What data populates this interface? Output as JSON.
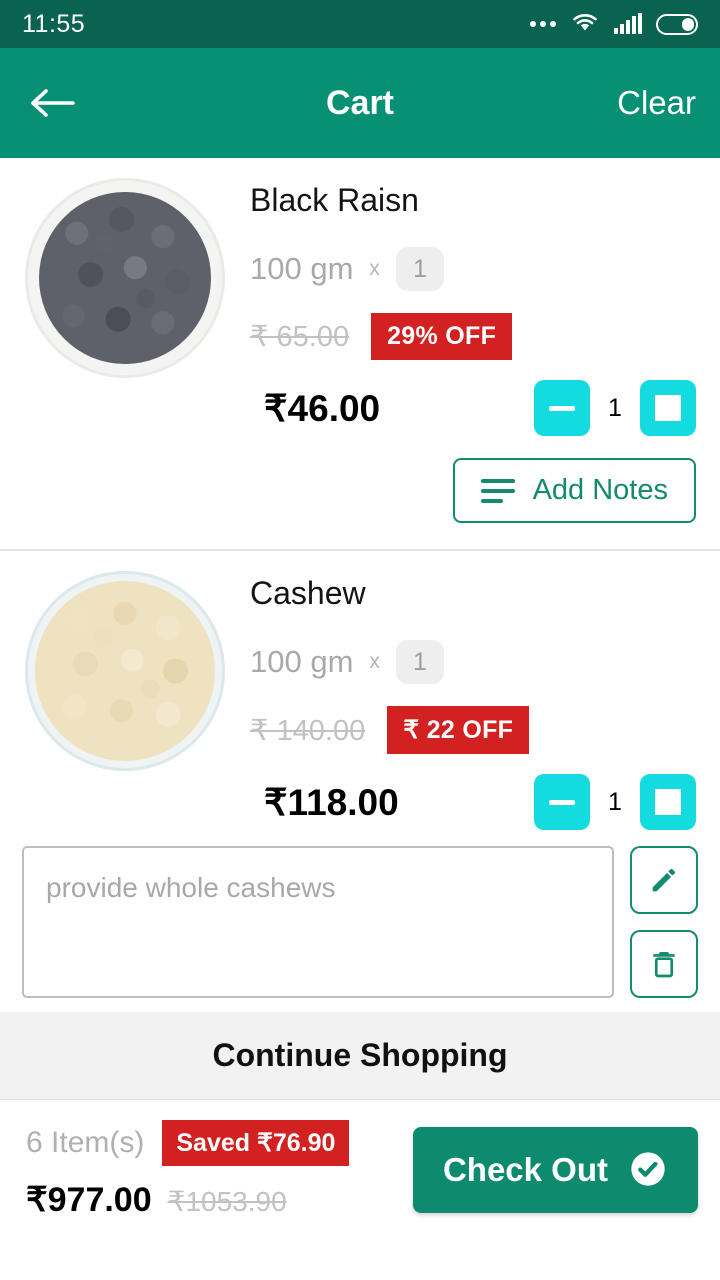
{
  "status_bar": {
    "time": "11:55",
    "icons": [
      "more-dots-icon",
      "wifi-icon",
      "signal-icon",
      "battery-icon"
    ],
    "background": "#0a6350"
  },
  "app_bar": {
    "back_icon": "back-arrow-icon",
    "title": "Cart",
    "clear_label": "Clear",
    "background": "#089074"
  },
  "cart": {
    "items": [
      {
        "name": "Black Raisn",
        "image": "black-raisins-bowl",
        "weight": "100 gm",
        "multiplier": "x",
        "pack_count": "1",
        "mrp": "₹ 65.00",
        "discount_badge": "29% OFF",
        "price": "₹46.00",
        "quantity": "1",
        "decrement_icon": "minus-icon",
        "increment_icon": "plus-icon",
        "notes_button_label": "Add Notes",
        "notes_icon": "list-lines-icon"
      },
      {
        "name": "Cashew",
        "image": "cashew-nuts-bowl",
        "weight": "100 gm",
        "multiplier": "x",
        "pack_count": "1",
        "mrp": "₹ 140.00",
        "discount_badge": "₹ 22 OFF",
        "price": "₹118.00",
        "quantity": "1",
        "decrement_icon": "minus-icon",
        "increment_icon": "plus-icon",
        "note_text": "provide whole cashews",
        "edit_icon": "pencil-icon",
        "delete_icon": "trash-icon"
      }
    ]
  },
  "continue_shopping": {
    "label": "Continue Shopping"
  },
  "summary": {
    "item_count": "6 Item(s)",
    "saved_badge": "Saved ₹76.90",
    "total": "₹977.00",
    "total_mrp": "₹1053.90",
    "checkout_label": "Check Out",
    "checkout_icon": "check-circle-icon"
  },
  "colors": {
    "status_bar": "#0a6350",
    "app_bar": "#089074",
    "accent_teal": "#148a6f",
    "stepper_cyan": "#13dbe0",
    "badge_red": "#d32020",
    "checkout_green": "#0e8a6e"
  }
}
